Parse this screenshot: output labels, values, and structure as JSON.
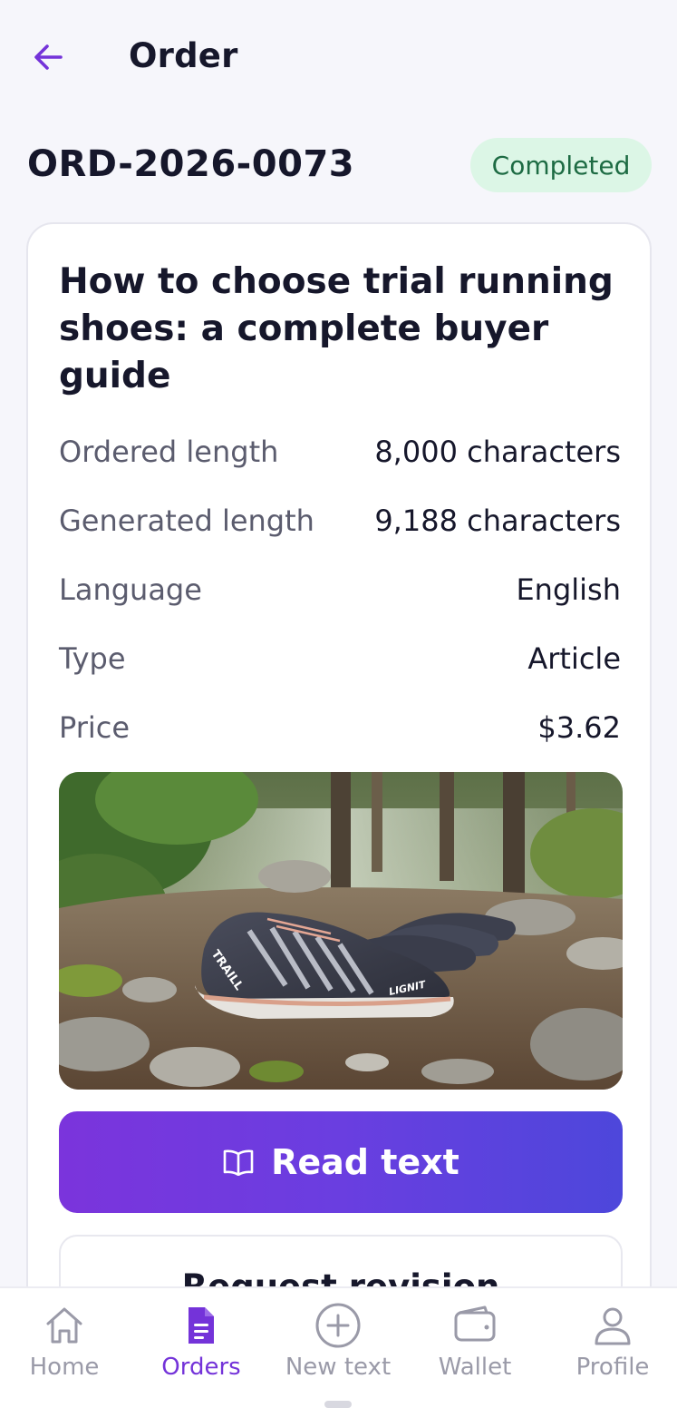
{
  "header": {
    "title": "Order",
    "back_icon": "arrow-left-icon",
    "accent_color": "#7433d9"
  },
  "order": {
    "id": "ORD-2026-0073",
    "status": "Completed",
    "status_bg": "#dcf6e6",
    "status_color": "#1d6b43"
  },
  "article": {
    "title": "How to choose trial running shoes: a complete buyer guide",
    "details": [
      {
        "label": "Ordered length",
        "value": "8,000 characters"
      },
      {
        "label": "Generated length",
        "value": "9,188 characters"
      },
      {
        "label": "Language",
        "value": "English"
      },
      {
        "label": "Type",
        "value": "Article"
      },
      {
        "label": "Price",
        "value": "$3.62"
      }
    ],
    "image": {
      "description_icon": "trail-running-shoes-photo",
      "shoe_text_1": "TRAILL",
      "shoe_text_2": "LIGNIT"
    }
  },
  "actions": {
    "read_label": "Read text",
    "read_icon": "open-book-icon",
    "revision_label": "Request revision"
  },
  "nav": {
    "items": [
      {
        "label": "Home",
        "icon": "home-icon",
        "active": false
      },
      {
        "label": "Orders",
        "icon": "document-icon",
        "active": true
      },
      {
        "label": "New text",
        "icon": "plus-circle-icon",
        "active": false
      },
      {
        "label": "Wallet",
        "icon": "wallet-icon",
        "active": false
      },
      {
        "label": "Profile",
        "icon": "user-icon",
        "active": false
      }
    ]
  }
}
